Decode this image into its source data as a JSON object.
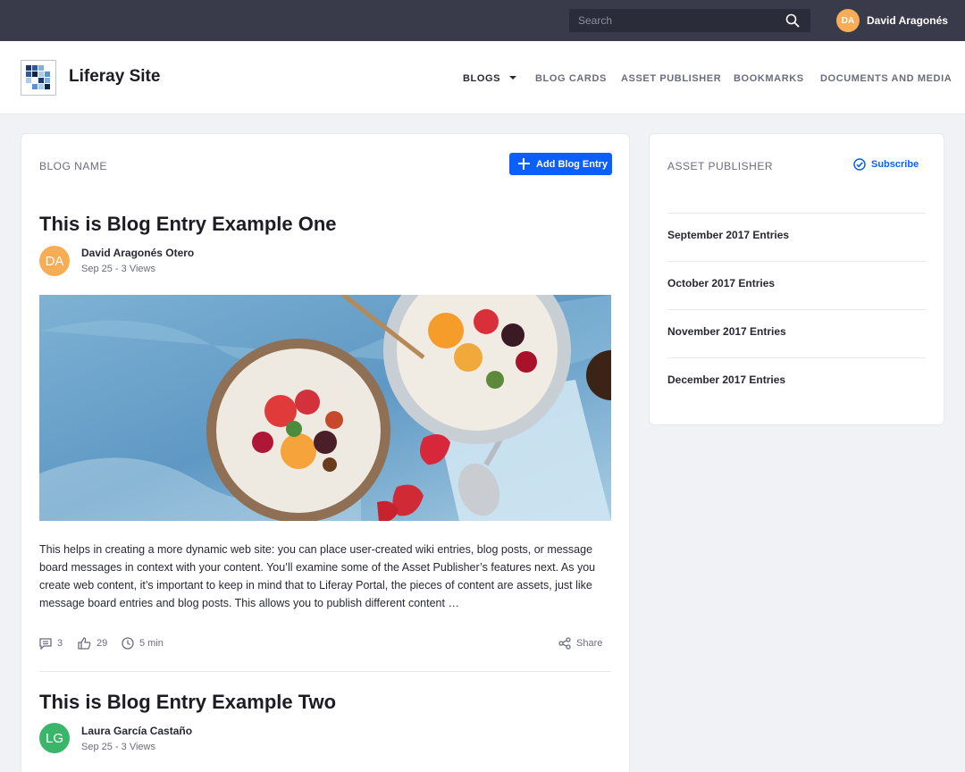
{
  "topbar": {
    "search_placeholder": "Search",
    "user_initials": "DA",
    "user_name": "David Aragonés"
  },
  "site": {
    "name": "Liferay Site",
    "nav": [
      {
        "label": "BLOGS",
        "active": true
      },
      {
        "label": "BLOG CARDS",
        "active": false
      },
      {
        "label": "ASSET PUBLISHER",
        "active": false
      },
      {
        "label": "BOOKMARKS",
        "active": false
      },
      {
        "label": "DOCUMENTS AND MEDIA",
        "active": false
      }
    ]
  },
  "blog": {
    "label": "BLOG NAME",
    "add_button": "Add Blog Entry",
    "entries": [
      {
        "title": "This is Blog Entry Example One",
        "author_initials": "DA",
        "author": "David Aragonés Otero",
        "meta": "Sep 25 - 3 Views",
        "avatar_color": "#f6ad56",
        "excerpt": "This helps in creating a more dynamic web site: you can place user-created wiki entries, blog posts, or message board messages in context with your content. You’ll examine some of the Asset Publisher’s features next. As you create web content, it’s important to keep in mind that to Liferay Portal, the pieces of content are assets, just like message board entries and blog posts. This allows you to publish different content …",
        "comments": "3",
        "likes": "29",
        "read_time": "5 min",
        "share": "Share"
      },
      {
        "title": "This is Blog Entry Example Two",
        "author_initials": "LG",
        "author": "Laura García Castaño",
        "meta": "Sep 25 - 3 Views",
        "avatar_color": "#3bb56a"
      }
    ]
  },
  "asset_publisher": {
    "label": "ASSET PUBLISHER",
    "subscribe": "Subscribe",
    "items": [
      "September 2017 Entries",
      "October 2017 Entries",
      "November 2017 Entries",
      "December 2017 Entries"
    ]
  },
  "colors": {
    "accent": "#0b5fff",
    "topbar": "#393a4a",
    "page_bg": "#f1f2f5"
  }
}
